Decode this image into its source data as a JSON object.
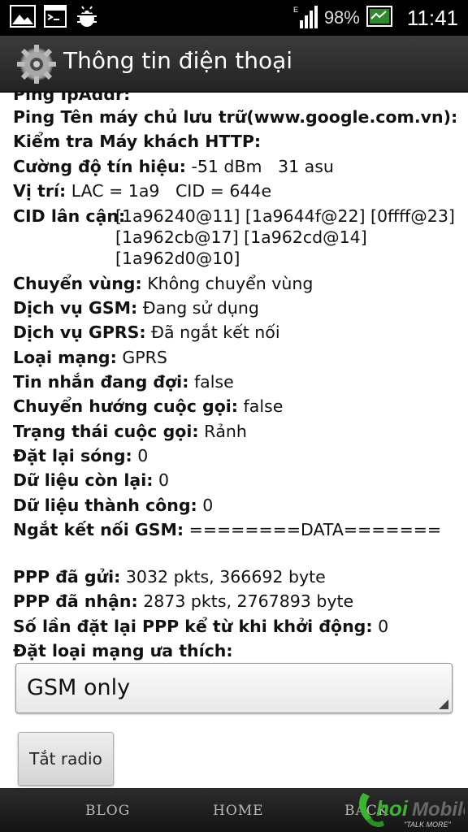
{
  "status": {
    "battery": "98%",
    "time": "11:41",
    "icons": [
      "image-icon",
      "terminal-icon",
      "android-debug-icon",
      "signal-icon",
      "battery-icon"
    ]
  },
  "titlebar": {
    "title": "Thông tin điện thoại",
    "icon": "settings-gear-icon"
  },
  "info": {
    "ping_ip_partial": "Ping IpAddr:",
    "ping_host": "Ping Tên máy chủ lưu trữ(www.google.com.vn):",
    "http_client": "Kiểm tra Máy khách HTTP:",
    "signal_label": "Cường độ tín hiệu:",
    "signal_value": "-51 dBm   31 asu",
    "location_label": "Vị trí:",
    "location_value": "LAC = 1a9   CID = 644e",
    "neighbor_label": "CID lân cận:",
    "neighbor_line1": "[1a96240@11] [1a9644f@22] [0ffff@23]",
    "neighbor_line2": "[1a962cb@17] [1a962cd@14]",
    "neighbor_line3": "[1a962d0@10]",
    "roaming_label": "Chuyển vùng:",
    "roaming_value": "Không chuyển vùng",
    "gsm_label": "Dịch vụ GSM:",
    "gsm_value": "Đang sử dụng",
    "gprs_label": "Dịch vụ GPRS:",
    "gprs_value": "Đã ngắt kết nối",
    "network_type_label": "Loại mạng:",
    "network_type_value": "GPRS",
    "msg_waiting_label": "Tin nhắn đang đợi:",
    "msg_waiting_value": "false",
    "call_redirect_label": "Chuyển hướng cuộc gọi:",
    "call_redirect_value": "false",
    "call_status_label": "Trạng thái cuộc gọi:",
    "call_status_value": "Rảnh",
    "radio_resets_label": "Đặt lại sóng:",
    "radio_resets_value": "0",
    "data_retries_label": "Dữ liệu còn lại:",
    "data_retries_value": "0",
    "data_success_label": "Dữ liệu thành công:",
    "data_success_value": "0",
    "gsm_disconnect_label": "Ngắt kết nối GSM:",
    "gsm_disconnect_value": "========DATA=======",
    "ppp_sent_label": "PPP đã gửi:",
    "ppp_sent_value": "3032 pkts, 366692 byte",
    "ppp_recv_label": "PPP đã nhận:",
    "ppp_recv_value": "2873 pkts, 2767893 byte",
    "ppp_reset_label": "Số lần đặt lại PPP kể từ khi khởi động:",
    "ppp_reset_value": "0",
    "preferred_network_label": "Đặt loại mạng ưa thích:"
  },
  "preferred_network_select": {
    "selected": "GSM only"
  },
  "radio_button": {
    "label": "Tắt radio"
  },
  "navbar": {
    "items": [
      "BLOG",
      "HOME",
      "BACK"
    ],
    "logo": "ThoiMobile",
    "logo_tagline": "TALK MORE"
  }
}
